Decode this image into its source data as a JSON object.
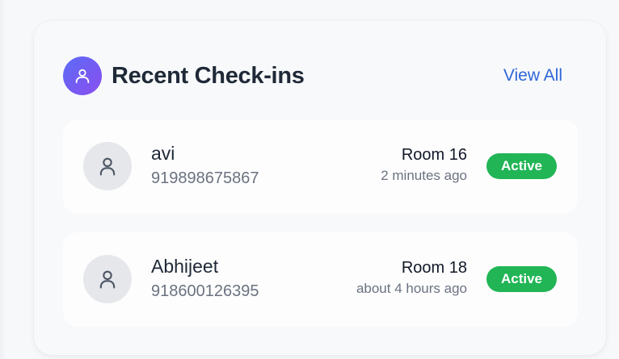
{
  "card": {
    "title": "Recent Check-ins",
    "view_all_label": "View All",
    "header_icon": "user-icon"
  },
  "checkins": [
    {
      "name": "avi",
      "phone": "919898675867",
      "room": "Room 16",
      "time_ago": "2 minutes ago",
      "status": "Active",
      "avatar_icon": "user-icon"
    },
    {
      "name": "Abhijeet",
      "phone": "918600126395",
      "room": "Room 18",
      "time_ago": "about 4 hours ago",
      "status": "Active",
      "avatar_icon": "user-icon"
    }
  ],
  "colors": {
    "accent": "#2f66d8",
    "status_active": "#21b556",
    "icon_gradient_start": "#5b6cf5",
    "icon_gradient_end": "#8b4df0"
  }
}
